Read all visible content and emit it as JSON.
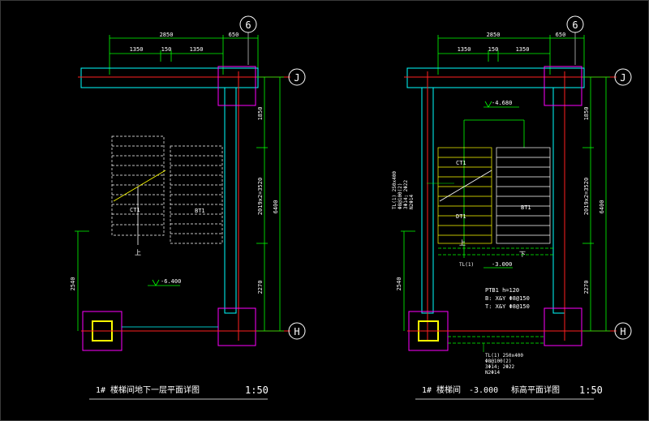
{
  "drawings": [
    {
      "title": "1# 楼梯间地下一层平面详图",
      "scale": "1:50",
      "axis_top": "6",
      "axis_right_top": "J",
      "axis_right_bottom": "H",
      "dims_top_overall": "2850",
      "dims_top_right": "650",
      "dims_top_parts": [
        "1350",
        "150",
        "1350"
      ],
      "dims_right": [
        "1850",
        "2019x2=3520",
        "2270"
      ],
      "dims_right_total": "6400",
      "dims_left": "2540",
      "level": "-6.400",
      "labels": {
        "flight_a": "CT1",
        "flight_b": "BT1",
        "up": "上"
      }
    },
    {
      "title_prefix": "1# 楼梯间",
      "title_level": "-3.000",
      "title_suffix": "标高平面详图",
      "scale": "1:50",
      "axis_top": "6",
      "axis_right_top": "J",
      "axis_right_bottom": "H",
      "dims_top_overall": "2850",
      "dims_top_right": "650",
      "dims_top_parts": [
        "1350",
        "150",
        "1350"
      ],
      "dims_right": [
        "1850",
        "2019x2=3520",
        "2270"
      ],
      "dims_right_total": "6400",
      "dims_left": "2540",
      "level_upper": "-4.680",
      "level_lower": "-3.000",
      "labels": {
        "flight_a": "CT1",
        "flight_b": "BT1",
        "flight_c": "DT1",
        "up": "上",
        "down": "下"
      },
      "note_vertical": [
        "TL(1) 250x400",
        "Φ8@100(2)",
        "3Φ14; 2Φ22",
        "N2Φ14"
      ],
      "tl_label": "TL(1)",
      "ptb_notes": [
        "PTB1 h=120",
        "B: X&Y Φ8@150",
        "T: X&Y Φ8@150"
      ],
      "tl_bottom_notes": [
        "TL(1) 250x400",
        "Φ8@100(2)",
        "3Φ14; 2Φ22",
        "N2Φ14"
      ]
    }
  ]
}
